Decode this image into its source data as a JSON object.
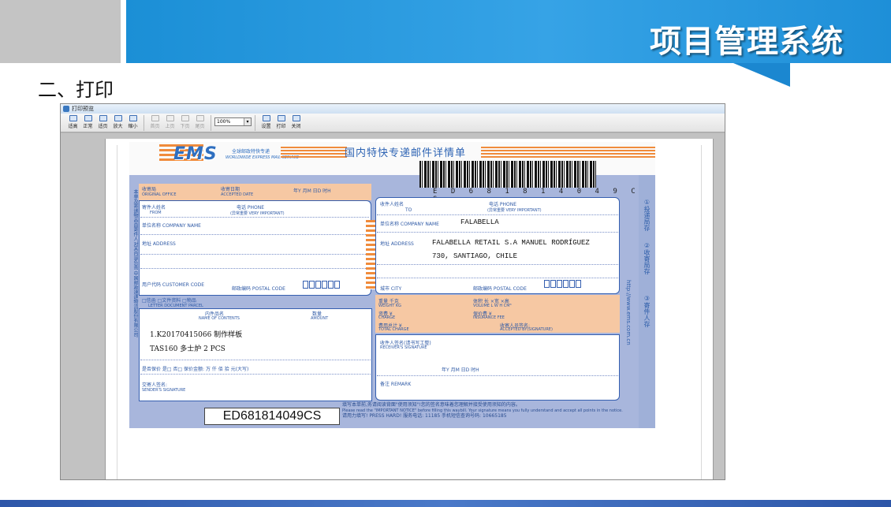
{
  "slide": {
    "title": "项目管理系统",
    "section": "二、打印"
  },
  "window": {
    "title": "打印预览",
    "toolbar": [
      {
        "label": "适高",
        "icon": "fit-height-icon",
        "enabled": true
      },
      {
        "label": "正常",
        "icon": "actual-size-icon",
        "enabled": true
      },
      {
        "label": "适页",
        "icon": "fit-page-icon",
        "enabled": true
      },
      {
        "label": "放大",
        "icon": "zoom-in-icon",
        "enabled": true
      },
      {
        "label": "缩小",
        "icon": "zoom-out-icon",
        "enabled": true
      },
      {
        "label": "首页",
        "icon": "first-page-icon",
        "enabled": false
      },
      {
        "label": "上页",
        "icon": "prev-page-icon",
        "enabled": false
      },
      {
        "label": "下页",
        "icon": "next-page-icon",
        "enabled": false
      },
      {
        "label": "尾页",
        "icon": "last-page-icon",
        "enabled": false
      },
      {
        "label": "设置",
        "icon": "settings-icon",
        "enabled": true
      },
      {
        "label": "打印",
        "icon": "printer-icon",
        "enabled": true
      },
      {
        "label": "关闭",
        "icon": "close-icon",
        "enabled": true
      }
    ],
    "zoom": "100%"
  },
  "waybill": {
    "brand": "EMS",
    "brand_cn": "全球邮政特快专递",
    "brand_en": "WORLDWIDE EXPRESS MAIL SERVICE",
    "title": "国内特快专递邮件详情单",
    "barcode_number": "E D 6 8 1 8 1 4 0 4 9 C S",
    "labels": {
      "original_office": "收寄局",
      "original_office_en": "ORIGINAL OFFICE",
      "accepted_date": "收寄日期",
      "accepted_date_en": "ACCEPTED DATE",
      "date_fields": "年Y 月M 日D 时H",
      "from": "寄件人姓名",
      "from_en": "FROM",
      "phone": "电话 PHONE",
      "phone_important": "(异常重要 VERY IMPORTANT)",
      "company_from": "单位名称 COMPANY NAME",
      "address_from": "地址 ADDRESS",
      "customer_code": "用户代码 CUSTOMER CODE",
      "postal_code_from": "邮政编码 POSTAL CODE",
      "to": "收件人姓名",
      "to_en": "TO",
      "company_to": "单位名称 COMPANY NAME",
      "address_to": "地址 ADDRESS",
      "city": "城市 CITY",
      "postal_code_to": "邮政编码 POSTAL CODE",
      "item_types": "□信函  □文件资料  □物品",
      "item_types_en": "LETTER   DOCUMENT   PARCEL",
      "contents": "内件品名",
      "contents_en": "NAME OF CONTENTS",
      "amount": "数量",
      "amount_en": "AMOUNT",
      "weight": "重量  千克",
      "weight_en": "WEIGHT  KG",
      "volume": "体积  长  ×宽  ×高",
      "volume_en": "VOLUME  L  W  H  CM³",
      "postage": "资费 ¥",
      "postage_en": "CHARGE",
      "insurance_fee": "保价费 ¥",
      "insurance_fee_en": "INSURANCE FEE",
      "total_charge": "费用总计 ¥",
      "total_charge_en": "TOTAL CHARGE",
      "accepted_signature": "收寄人员签名:",
      "accepted_signature_en": "ACCEPTED BY(SIGNATURE)",
      "receiver_signature": "收件人签名(请书写工整)",
      "receiver_signature_en": "RECEIVER'S SIGNATURE",
      "insured": "是否保价  是□  否□  保价金额:    万  仟  佰  拾  元(大写)",
      "sender_signature": "交寄人签名:",
      "sender_signature_en": "SENDER'S SIGNATURE",
      "remark": "备注 REMARK",
      "side_left": "本单及寄递物品由寄件人对其内容负责 中国邮政速递物流股份有限公司",
      "side_right_1": "①投递局存",
      "side_right_2": "②收寄局存",
      "side_right_3": "③寄件人存",
      "side_url": "http://www.ems.com.cn"
    },
    "receiver": {
      "company": "FALABELLA",
      "address_line1": "FALABELLA RETAIL S.A MANUEL RODRÍGUEZ",
      "address_line2": "730, SANTIAGO, CHILE"
    },
    "contents": {
      "line1": "1.K20170415066     制作样板",
      "line2": "TAS160 多士炉 2 PCS"
    },
    "waybill_no": "ED681814049CS",
    "notice_1": "填写本单前,务请阅读背面\"使用须知\"!您的签名意味着您理解并接受使用须知的内容。",
    "notice_2": "Please read the \"IMPORTANT NOTICE\" before filling this waybill. Your signature means you fully understand and accept all points in the notice.",
    "notice_3": "请用力填写!   PRESS HARD!   服务电话: 11185   手机短信查询号码: 10665185"
  }
}
